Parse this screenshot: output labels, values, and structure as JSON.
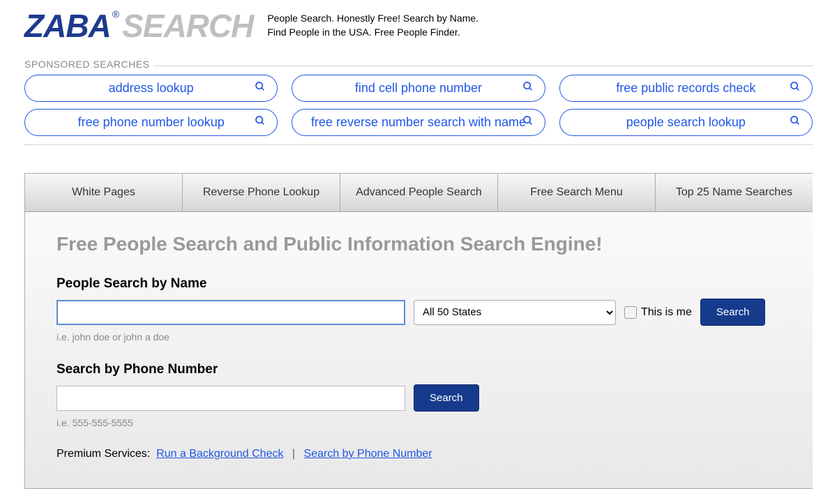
{
  "logo": {
    "part1": "ZABA",
    "reg": "®",
    "part2": "SEARCH"
  },
  "tagline": {
    "line1": "People Search. Honestly Free! Search by Name.",
    "line2": "Find People in the USA. Free People Finder."
  },
  "sponsored": {
    "label": "SPONSORED SEARCHES",
    "items": [
      "address lookup",
      "find cell phone number",
      "free public records check",
      "free phone number lookup",
      "free reverse number search with name",
      "people search lookup"
    ]
  },
  "nav": [
    "White Pages",
    "Reverse Phone Lookup",
    "Advanced People Search",
    "Free Search Menu",
    "Top 25 Name Searches"
  ],
  "page_title": "Free People Search and Public Information Search Engine!",
  "name_search": {
    "label": "People Search by Name",
    "state": "All 50 States",
    "checkbox_label": "This is me",
    "button": "Search",
    "hint": "i.e. john doe or john a doe"
  },
  "phone_search": {
    "label": "Search by Phone Number",
    "button": "Search",
    "hint": "i.e. 555-555-5555"
  },
  "premium": {
    "label": "Premium Services:",
    "link1": "Run a Background Check",
    "sep": "|",
    "link2": "Search by Phone Number"
  }
}
